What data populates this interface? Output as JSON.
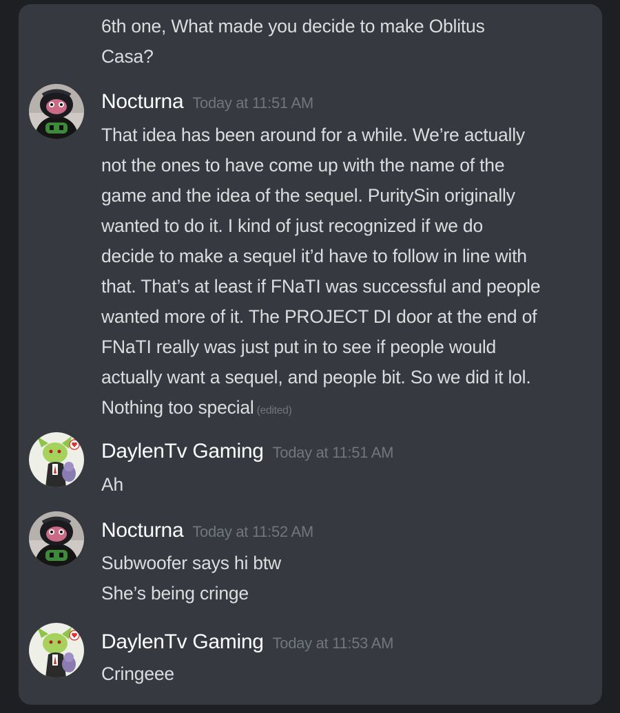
{
  "top_message": {
    "lines": [
      "6th one, What made you decide to make Oblitus",
      "Casa?"
    ]
  },
  "messages": [
    {
      "author": "Nocturna",
      "timestamp": "Today at 11:51 AM",
      "avatar": "nocturna-avatar",
      "lines": [
        "That idea has been around for a while. We’re actually",
        "not the ones to have come up with the name of the",
        "game and the idea of the sequel. PuritySin originally",
        "wanted to do it. I kind of just recognized if we do",
        "decide to make a sequel it’d have to follow in line with",
        "that. That’s at least if FNaTI was successful and people",
        "wanted more of it. The PROJECT DI door at the end of",
        "FNaTI really was just put in to see if people would",
        "actually want a sequel, and people bit. So we did it lol.",
        "Nothing too special"
      ],
      "edited_label": "(edited)"
    },
    {
      "author": "DaylenTv Gaming",
      "timestamp": "Today at 11:51 AM",
      "avatar": "daylen-avatar",
      "lines": [
        "Ah"
      ]
    },
    {
      "author": "Nocturna",
      "timestamp": "Today at 11:52 AM",
      "avatar": "nocturna-avatar",
      "lines": [
        "Subwoofer says hi btw",
        "She’s being cringe"
      ]
    },
    {
      "author": "DaylenTv Gaming",
      "timestamp": "Today at 11:53 AM",
      "avatar": "daylen-avatar",
      "lines": [
        "Cringeee"
      ]
    }
  ],
  "colors": {
    "background": "#1e1f22",
    "panel": "#36393f",
    "text": "#dcddde",
    "username": "#ffffff",
    "timestamp": "#72767d"
  }
}
